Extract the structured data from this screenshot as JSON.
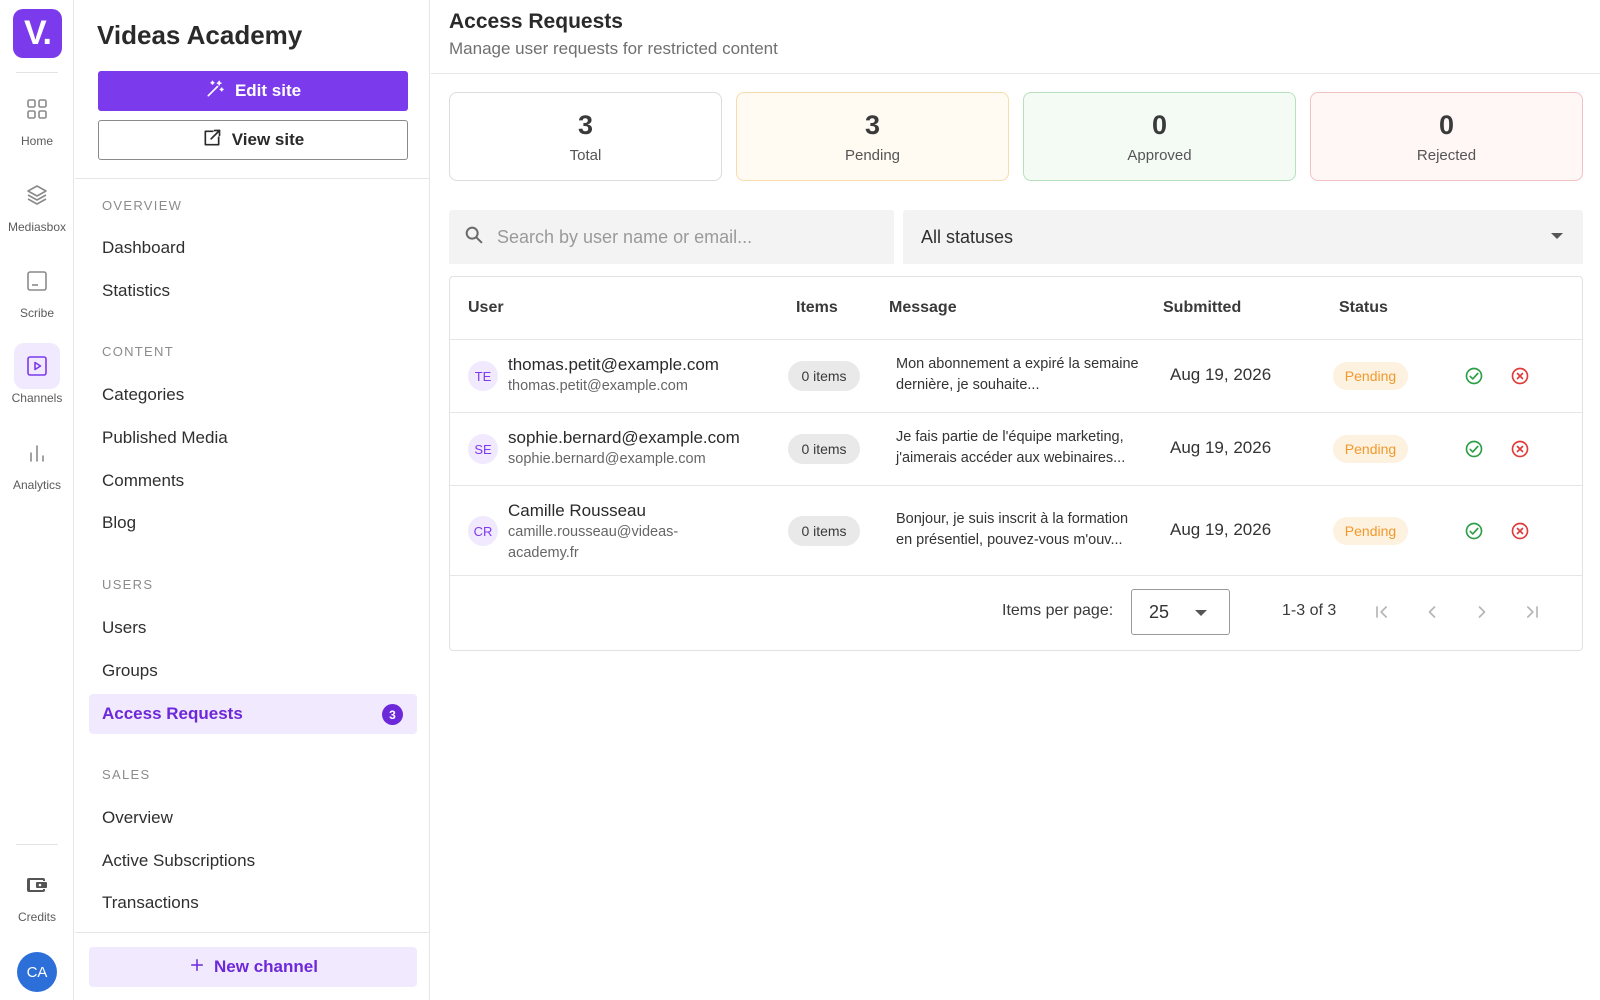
{
  "rail": {
    "logo": "V.",
    "items": [
      {
        "label": "Home",
        "icon": "grid-icon"
      },
      {
        "label": "Mediasbox",
        "icon": "layers-icon"
      },
      {
        "label": "Scribe",
        "icon": "document-icon"
      },
      {
        "label": "Channels",
        "icon": "play-square-icon",
        "active": true
      },
      {
        "label": "Analytics",
        "icon": "bar-chart-icon"
      }
    ],
    "credits": {
      "label": "Credits",
      "icon": "wallet-icon"
    },
    "avatar": "CA"
  },
  "sidebar": {
    "site_name": "Videas Academy",
    "edit_site": "Edit site",
    "view_site": "View site",
    "sections": {
      "overview": "OVERVIEW",
      "content": "CONTENT",
      "users": "USERS",
      "sales": "SALES"
    },
    "items": {
      "dashboard": "Dashboard",
      "statistics": "Statistics",
      "categories": "Categories",
      "published_media": "Published Media",
      "comments": "Comments",
      "blog": "Blog",
      "users": "Users",
      "groups": "Groups",
      "access_requests": "Access Requests",
      "access_requests_badge": "3",
      "sales_overview": "Overview",
      "active_subscriptions": "Active Subscriptions",
      "transactions": "Transactions"
    },
    "new_channel": "New channel"
  },
  "header": {
    "title": "Access Requests",
    "subtitle": "Manage user requests for restricted content"
  },
  "stats": [
    {
      "value": "3",
      "label": "Total"
    },
    {
      "value": "3",
      "label": "Pending"
    },
    {
      "value": "0",
      "label": "Approved"
    },
    {
      "value": "0",
      "label": "Rejected"
    }
  ],
  "filters": {
    "search_placeholder": "Search by user name or email...",
    "status_value": "All statuses"
  },
  "table": {
    "columns": [
      "User",
      "Items",
      "Message",
      "Submitted",
      "Status"
    ],
    "rows": [
      {
        "initials": "TE",
        "name": "thomas.petit@example.com",
        "email": "thomas.petit@example.com",
        "items": "0 items",
        "message": "Mon abonnement a expiré la semaine dernière, je souhaite...",
        "submitted": "Aug 19, 2026",
        "status": "Pending"
      },
      {
        "initials": "SE",
        "name": "sophie.bernard@example.com",
        "email": "sophie.bernard@example.com",
        "items": "0 items",
        "message": "Je fais partie de l'équipe marketing, j'aimerais accéder aux webinaires...",
        "submitted": "Aug 19, 2026",
        "status": "Pending"
      },
      {
        "initials": "CR",
        "name": "Camille Rousseau",
        "email": "camille.rousseau@videas-academy.fr",
        "items": "0 items",
        "message": "Bonjour, je suis inscrit à la formation en présentiel, pouvez-vous m'ouv...",
        "submitted": "Aug 19, 2026",
        "status": "Pending"
      }
    ]
  },
  "pagination": {
    "items_per_page_label": "Items per page:",
    "items_per_page": "25",
    "range": "1-3 of 3"
  },
  "colors": {
    "accent": "#7c3aed",
    "pending": "#f09a2c",
    "approve": "#2e9e47",
    "reject": "#e03b3b"
  }
}
